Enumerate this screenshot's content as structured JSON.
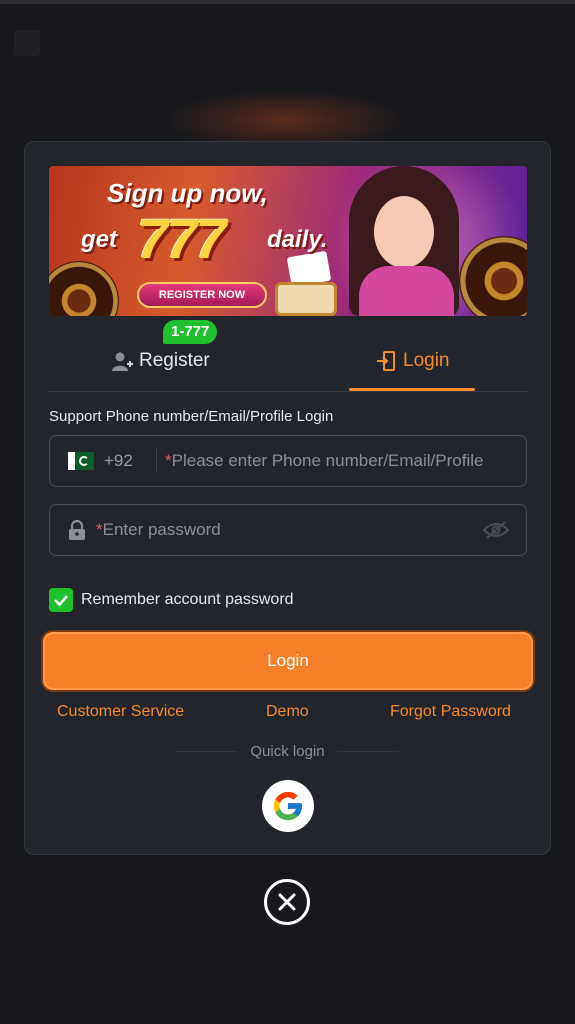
{
  "banner": {
    "headline": "Sign up now,",
    "get": "get",
    "amount": "777",
    "daily": "daily.",
    "button_label": "REGISTER NOW"
  },
  "tabs": {
    "register": {
      "label": "Register",
      "badge": "1-777",
      "icon": "user-add-icon"
    },
    "login": {
      "label": "Login",
      "icon": "login-door-icon",
      "active": true
    }
  },
  "form": {
    "support_label": "Support Phone number/Email/Profile Login",
    "country_code": "+92",
    "country_flag": "pakistan-flag-icon",
    "account_required_mark": "*",
    "account_placeholder": "Please enter Phone number/Email/Profile",
    "password_required_mark": "*",
    "password_placeholder": "Enter password",
    "remember_label": "Remember account password",
    "remember_checked": true,
    "submit_label": "Login"
  },
  "links": {
    "customer_service": "Customer Service",
    "demo": "Demo",
    "forgot_password": "Forgot Password"
  },
  "quick_login": {
    "label": "Quick login",
    "providers": [
      "google-icon"
    ]
  },
  "colors": {
    "accent": "#f68b2b",
    "badge": "#1fc02e",
    "background": "#17181c",
    "modal": "#23252c"
  }
}
